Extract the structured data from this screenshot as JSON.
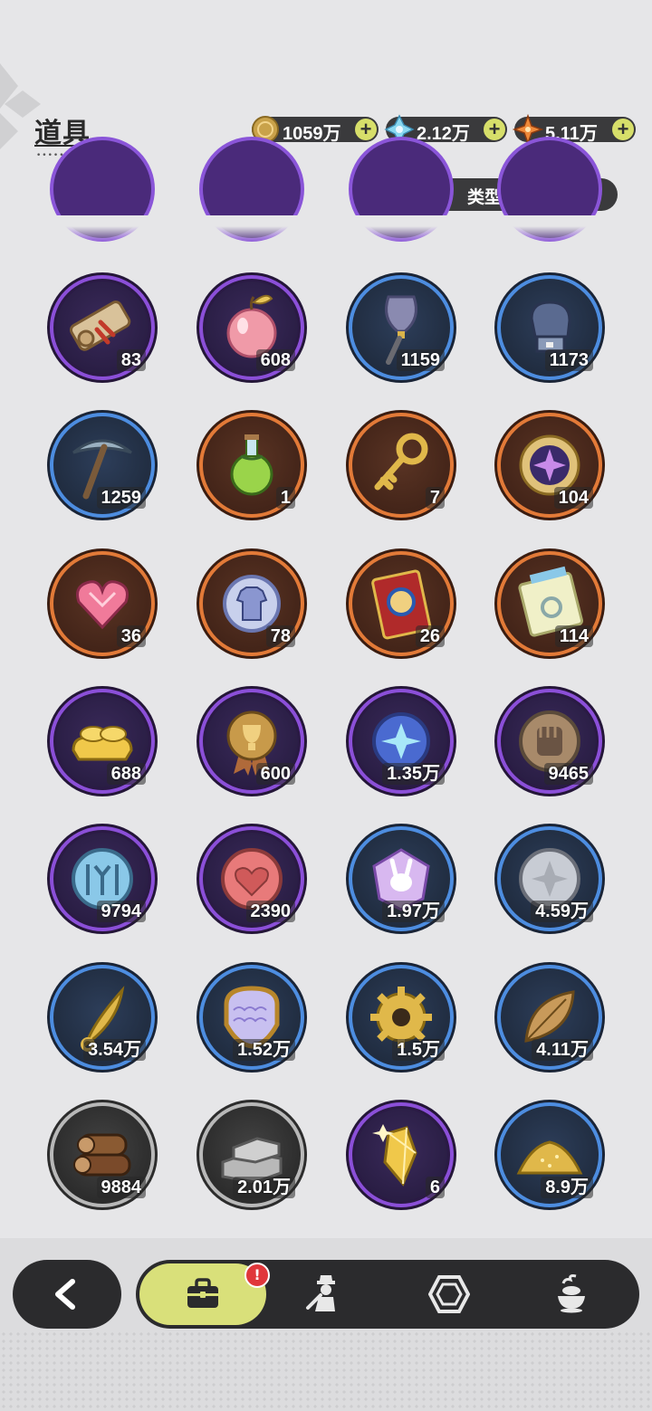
{
  "header": {
    "title": "道具"
  },
  "currencies": [
    {
      "icon": "gold-coin-icon",
      "value": "1059万"
    },
    {
      "icon": "crystal-icon",
      "value": "2.12万"
    },
    {
      "icon": "star-shard-icon",
      "value": "5.11万"
    }
  ],
  "filter": {
    "label": "类型"
  },
  "items": [
    {
      "icon": "scroll-icon",
      "rarity": "purple",
      "count": "83"
    },
    {
      "icon": "apple-icon",
      "rarity": "purple",
      "count": "608"
    },
    {
      "icon": "shovel-icon",
      "rarity": "blue",
      "count": "1159"
    },
    {
      "icon": "gauntlet-icon",
      "rarity": "blue",
      "count": "1173"
    },
    {
      "icon": "pickaxe-icon",
      "rarity": "blue",
      "count": "1259"
    },
    {
      "icon": "potion-icon",
      "rarity": "orange",
      "count": "1"
    },
    {
      "icon": "key-icon",
      "rarity": "orange",
      "count": "7"
    },
    {
      "icon": "emblem-icon",
      "rarity": "orange",
      "count": "104"
    },
    {
      "icon": "gem-heart-icon",
      "rarity": "orange",
      "count": "36"
    },
    {
      "icon": "outfit-coin-icon",
      "rarity": "orange",
      "count": "78"
    },
    {
      "icon": "ticket-icon",
      "rarity": "orange",
      "count": "26"
    },
    {
      "icon": "rainbow-ticket-icon",
      "rarity": "orange",
      "count": "114"
    },
    {
      "icon": "gold-ingot-icon",
      "rarity": "purple",
      "count": "688"
    },
    {
      "icon": "trophy-medal-icon",
      "rarity": "purple",
      "count": "600"
    },
    {
      "icon": "star-coin-icon",
      "rarity": "purple",
      "count": "1.35万"
    },
    {
      "icon": "fist-coin-icon",
      "rarity": "purple",
      "count": "9465"
    },
    {
      "icon": "blue-coin-icon",
      "rarity": "purple",
      "count": "9794"
    },
    {
      "icon": "heart-coin-icon",
      "rarity": "purple",
      "count": "2390"
    },
    {
      "icon": "bunny-badge-icon",
      "rarity": "blue",
      "count": "1.97万"
    },
    {
      "icon": "silver-coin-icon",
      "rarity": "blue",
      "count": "4.59万"
    },
    {
      "icon": "blade-icon",
      "rarity": "blue",
      "count": "3.54万"
    },
    {
      "icon": "scale-shield-icon",
      "rarity": "blue",
      "count": "1.52万"
    },
    {
      "icon": "gear-icon",
      "rarity": "blue",
      "count": "1.5万"
    },
    {
      "icon": "leaf-icon",
      "rarity": "blue",
      "count": "4.11万"
    },
    {
      "icon": "wood-logs-icon",
      "rarity": "grey",
      "count": "9884"
    },
    {
      "icon": "stone-bricks-icon",
      "rarity": "grey",
      "count": "2.01万"
    },
    {
      "icon": "gold-crystal-icon",
      "rarity": "purple",
      "count": "6"
    },
    {
      "icon": "gold-dust-icon",
      "rarity": "blue",
      "count": "8.9万"
    }
  ],
  "nav": {
    "back_icon": "chevron-left-icon",
    "tabs": [
      {
        "icon": "bag-icon",
        "active": true,
        "badge": "!"
      },
      {
        "icon": "character-icon",
        "active": false
      },
      {
        "icon": "hexagon-gem-icon",
        "active": false
      },
      {
        "icon": "food-icon",
        "active": false
      }
    ]
  },
  "colors": {
    "purple": "#8b4fd8",
    "blue": "#4d8de0",
    "orange": "#e27a38",
    "grey": "#b8b8b8",
    "accent": "#d9e07a"
  }
}
